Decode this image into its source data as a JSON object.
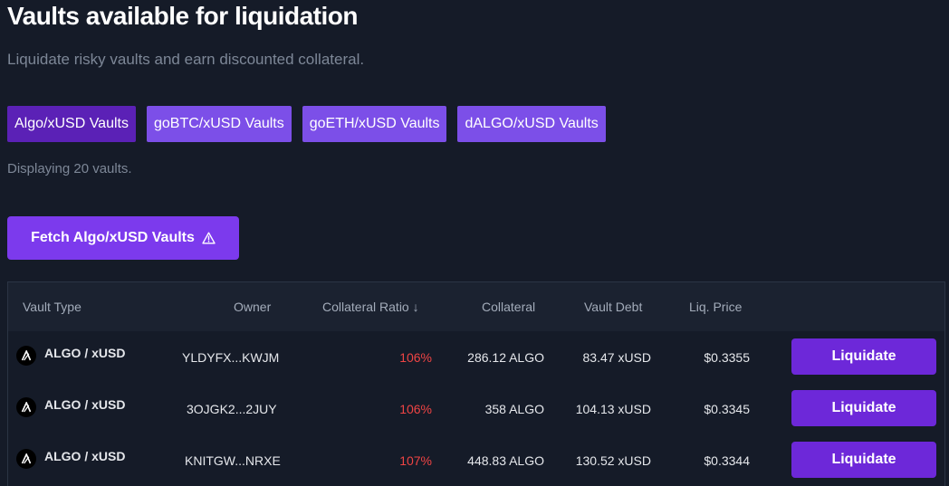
{
  "header": {
    "title": "Vaults available for liquidation",
    "subtitle": "Liquidate risky vaults and earn discounted collateral."
  },
  "tabs": [
    {
      "label": "Algo/xUSD Vaults",
      "active": true
    },
    {
      "label": "goBTC/xUSD Vaults",
      "active": false
    },
    {
      "label": "goETH/xUSD Vaults",
      "active": false
    },
    {
      "label": "dALGO/xUSD Vaults",
      "active": false
    }
  ],
  "display_count": "Displaying 20 vaults.",
  "fetch_button": {
    "label": "Fetch Algo/xUSD Vaults",
    "icon": "warning-triangle-icon"
  },
  "table": {
    "columns": {
      "vault_type": "Vault Type",
      "owner": "Owner",
      "collateral_ratio": "Collateral Ratio ↓",
      "collateral": "Collateral",
      "vault_debt": "Vault Debt",
      "liq_price": "Liq. Price"
    },
    "rows": [
      {
        "type": "ALGO / xUSD",
        "owner": "YLDYFX...KWJM",
        "ratio": "106%",
        "collateral": "286.12 ALGO",
        "debt": "83.47 xUSD",
        "liq_price": "$0.3355",
        "action": "Liquidate"
      },
      {
        "type": "ALGO / xUSD",
        "owner": "3OJGK2...2JUY",
        "ratio": "106%",
        "collateral": "358 ALGO",
        "debt": "104.13 xUSD",
        "liq_price": "$0.3345",
        "action": "Liquidate"
      },
      {
        "type": "ALGO / xUSD",
        "owner": "KNITGW...NRXE",
        "ratio": "107%",
        "collateral": "448.83 ALGO",
        "debt": "130.52 xUSD",
        "liq_price": "$0.3344",
        "action": "Liquidate"
      }
    ]
  },
  "colors": {
    "background": "#151b28",
    "accent": "#7c3aed",
    "tab_active": "#5b21b6",
    "tab_inactive": "#7c4fe8",
    "ratio_danger": "#ef4444"
  }
}
